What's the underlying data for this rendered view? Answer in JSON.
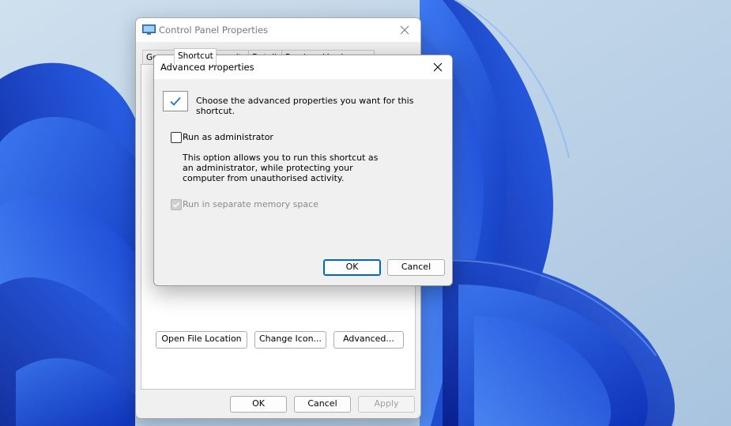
{
  "back_window": {
    "title": "Control Panel Properties",
    "tabs": [
      "General",
      "Shortcut",
      "Security",
      "Details",
      "Previous Versions"
    ],
    "panel_buttons": {
      "open_file_location": "Open File Location",
      "change_icon": "Change Icon...",
      "advanced": "Advanced..."
    },
    "bottom_buttons": {
      "ok": "OK",
      "cancel": "Cancel",
      "apply": "Apply"
    }
  },
  "dialog": {
    "title": "Advanced Properties",
    "intro": "Choose the advanced properties you want for this shortcut.",
    "run_as_admin": {
      "label": "Run as administrator",
      "checked": false
    },
    "description": "This option allows you to run this shortcut as an administrator, while protecting your computer from unauthorised activity.",
    "separate_memory": {
      "label": "Run in separate memory space",
      "checked": true,
      "disabled": true
    },
    "buttons": {
      "ok": "OK",
      "cancel": "Cancel"
    }
  },
  "colors": {
    "accent": "#0067c0",
    "wallpaper_blue": "#1b4fd6",
    "wallpaper_bg": "#b7cfe6"
  },
  "icons": [
    "control-panel-icon",
    "close-icon",
    "checkmark-icon"
  ]
}
